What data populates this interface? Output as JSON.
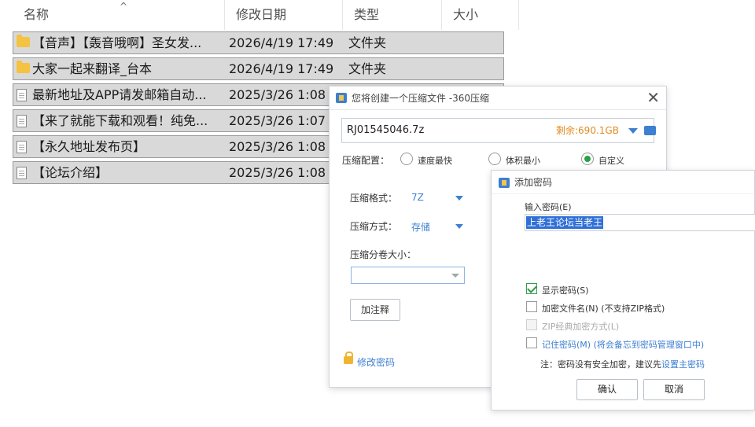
{
  "explorer": {
    "columns": {
      "name": "名称",
      "date": "修改日期",
      "type": "类型",
      "size": "大小"
    },
    "sort_arrow": "^",
    "rows": [
      {
        "icon": "folder-icon",
        "name": "【音声】【轰音哦啊】圣女发...",
        "date": "2026/4/19 17:49",
        "type": "文件夹"
      },
      {
        "icon": "folder-icon",
        "name": "大家一起来翻译_台本",
        "date": "2026/4/19 17:49",
        "type": "文件夹"
      },
      {
        "icon": "file-icon",
        "name": "最新地址及APP请发邮箱自动...",
        "date": "2025/3/26 1:08",
        "type": ""
      },
      {
        "icon": "file-icon",
        "name": "【来了就能下载和观看！纯免...",
        "date": "2025/3/26 1:07",
        "type": ""
      },
      {
        "icon": "file-icon",
        "name": "【永久地址发布页】",
        "date": "2025/3/26 1:08",
        "type": ""
      },
      {
        "icon": "file-icon",
        "name": "【论坛介绍】",
        "date": "2025/3/26 1:08",
        "type": ""
      }
    ]
  },
  "compress_dialog": {
    "title": "您将创建一个压缩文件 -360压缩",
    "close_glyph": "✕",
    "path_value": "RJ01545046.7z",
    "free_space": "剩余:690.1GB",
    "config_label": "压缩配置：",
    "radios": [
      {
        "label": "速度最快",
        "selected": false
      },
      {
        "label": "体积最小",
        "selected": false
      },
      {
        "label": "自定义",
        "selected": true
      }
    ],
    "format_label": "压缩格式：",
    "format_value": "7Z",
    "method_label": "压缩方式：",
    "method_value": "存储",
    "volume_label": "压缩分卷大小：",
    "comment_button": "加注释",
    "modify_password": "修改密码"
  },
  "password_dialog": {
    "title": "添加密码",
    "input_label": "输入密码(E)",
    "password_value": "上老王论坛当老王",
    "checkboxes": [
      {
        "label": "显示密码(S)",
        "checked": true,
        "disabled": false,
        "link": false
      },
      {
        "label": "加密文件名(N) (不支持ZIP格式)",
        "checked": false,
        "disabled": false,
        "link": false
      },
      {
        "label": "ZIP经典加密方式(L)",
        "checked": false,
        "disabled": true,
        "link": false
      },
      {
        "label": "记住密码(M) (将会备忘到密码管理窗口中)",
        "checked": false,
        "disabled": false,
        "link": true
      }
    ],
    "note_prefix": "注：密码没有安全加密，建议先",
    "note_link": "设置主密码",
    "ok_button": "确认",
    "cancel_button": "取消"
  },
  "colors": {
    "selection_row": "#d9d9d9",
    "accent_blue": "#3d7fd1",
    "free_space_orange": "#e28b1f",
    "radio_green": "#27a046",
    "password_selection": "#2f6fd6"
  }
}
